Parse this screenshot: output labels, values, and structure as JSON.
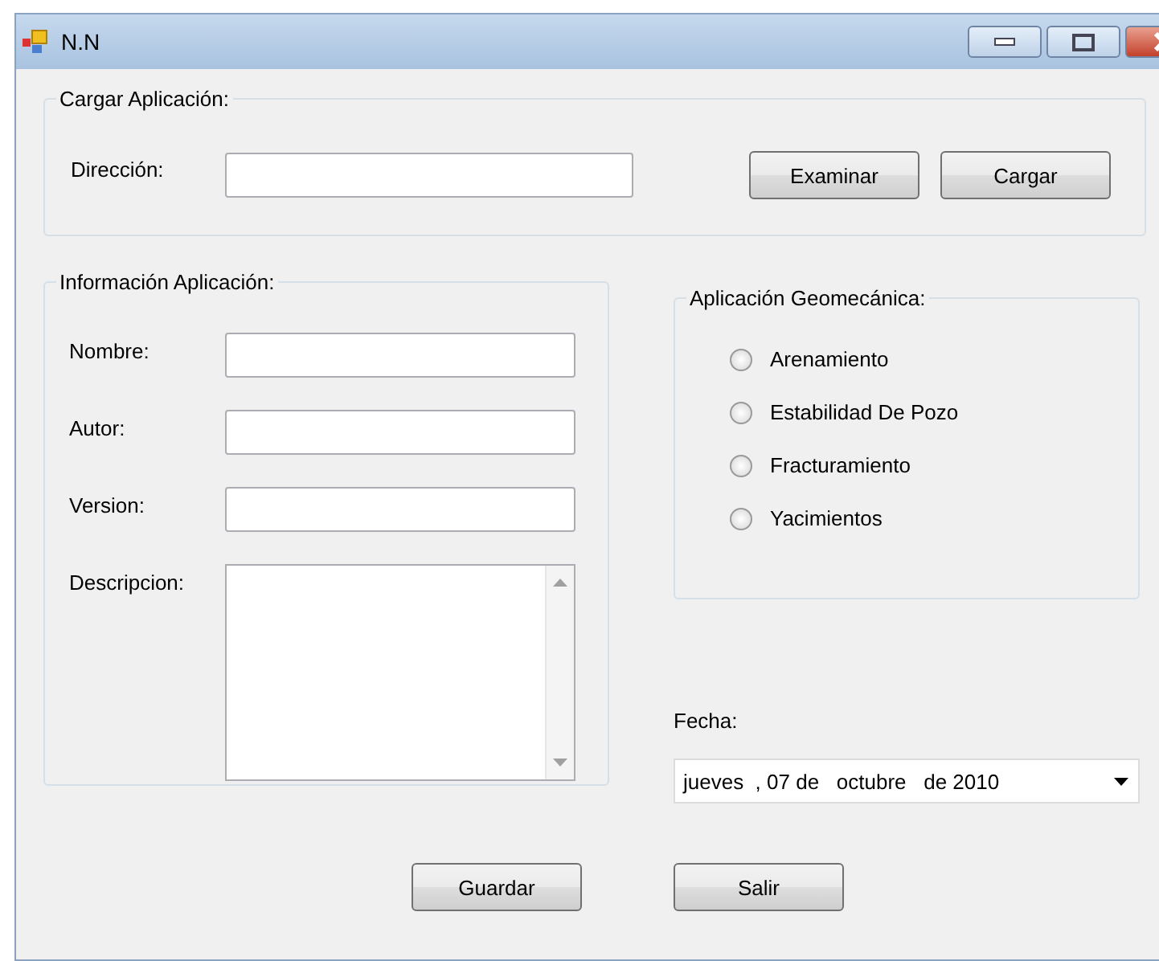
{
  "window": {
    "title": "N.N"
  },
  "load_group": {
    "legend": "Cargar Aplicación:",
    "label": "Dirección:",
    "buttons": [
      "Examinar",
      "Cargar"
    ]
  },
  "info_group": {
    "legend": "Información Aplicación:",
    "fields": [
      {
        "label": "Nombre:",
        "kind": "text"
      },
      {
        "label": "Autor:",
        "kind": "text"
      },
      {
        "label": "Version:",
        "kind": "text"
      },
      {
        "label": "Descripcion:",
        "kind": "multiline"
      }
    ]
  },
  "geo_group": {
    "legend": "Aplicación Geomecánica:",
    "options": [
      {
        "label": "Arenamiento",
        "selected": false
      },
      {
        "label": "Estabilidad De Pozo",
        "selected": false
      },
      {
        "label": "Fracturamiento",
        "selected": false
      },
      {
        "label": "Yacimientos",
        "selected": false
      }
    ]
  },
  "date": {
    "label": "Fecha:",
    "value": "jueves  , 07 de   octubre   de 2010"
  },
  "footer_buttons": [
    "Guardar",
    "Salir"
  ]
}
